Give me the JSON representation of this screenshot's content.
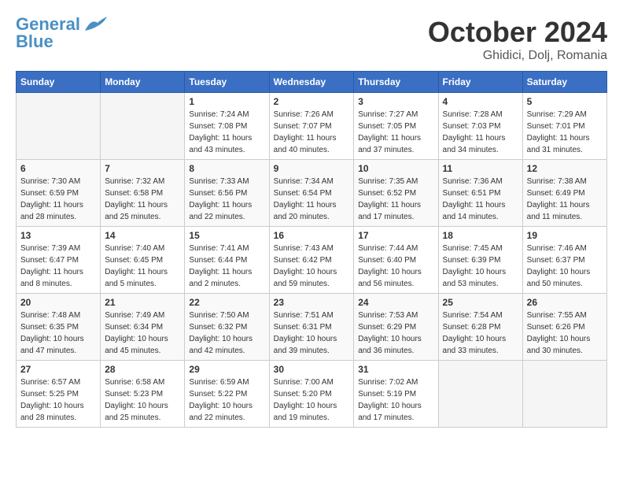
{
  "header": {
    "logo_line1": "General",
    "logo_line2": "Blue",
    "month": "October 2024",
    "location": "Ghidici, Dolj, Romania"
  },
  "weekdays": [
    "Sunday",
    "Monday",
    "Tuesday",
    "Wednesday",
    "Thursday",
    "Friday",
    "Saturday"
  ],
  "weeks": [
    [
      {
        "day": "",
        "info": ""
      },
      {
        "day": "",
        "info": ""
      },
      {
        "day": "1",
        "info": "Sunrise: 7:24 AM\nSunset: 7:08 PM\nDaylight: 11 hours and 43 minutes."
      },
      {
        "day": "2",
        "info": "Sunrise: 7:26 AM\nSunset: 7:07 PM\nDaylight: 11 hours and 40 minutes."
      },
      {
        "day": "3",
        "info": "Sunrise: 7:27 AM\nSunset: 7:05 PM\nDaylight: 11 hours and 37 minutes."
      },
      {
        "day": "4",
        "info": "Sunrise: 7:28 AM\nSunset: 7:03 PM\nDaylight: 11 hours and 34 minutes."
      },
      {
        "day": "5",
        "info": "Sunrise: 7:29 AM\nSunset: 7:01 PM\nDaylight: 11 hours and 31 minutes."
      }
    ],
    [
      {
        "day": "6",
        "info": "Sunrise: 7:30 AM\nSunset: 6:59 PM\nDaylight: 11 hours and 28 minutes."
      },
      {
        "day": "7",
        "info": "Sunrise: 7:32 AM\nSunset: 6:58 PM\nDaylight: 11 hours and 25 minutes."
      },
      {
        "day": "8",
        "info": "Sunrise: 7:33 AM\nSunset: 6:56 PM\nDaylight: 11 hours and 22 minutes."
      },
      {
        "day": "9",
        "info": "Sunrise: 7:34 AM\nSunset: 6:54 PM\nDaylight: 11 hours and 20 minutes."
      },
      {
        "day": "10",
        "info": "Sunrise: 7:35 AM\nSunset: 6:52 PM\nDaylight: 11 hours and 17 minutes."
      },
      {
        "day": "11",
        "info": "Sunrise: 7:36 AM\nSunset: 6:51 PM\nDaylight: 11 hours and 14 minutes."
      },
      {
        "day": "12",
        "info": "Sunrise: 7:38 AM\nSunset: 6:49 PM\nDaylight: 11 hours and 11 minutes."
      }
    ],
    [
      {
        "day": "13",
        "info": "Sunrise: 7:39 AM\nSunset: 6:47 PM\nDaylight: 11 hours and 8 minutes."
      },
      {
        "day": "14",
        "info": "Sunrise: 7:40 AM\nSunset: 6:45 PM\nDaylight: 11 hours and 5 minutes."
      },
      {
        "day": "15",
        "info": "Sunrise: 7:41 AM\nSunset: 6:44 PM\nDaylight: 11 hours and 2 minutes."
      },
      {
        "day": "16",
        "info": "Sunrise: 7:43 AM\nSunset: 6:42 PM\nDaylight: 10 hours and 59 minutes."
      },
      {
        "day": "17",
        "info": "Sunrise: 7:44 AM\nSunset: 6:40 PM\nDaylight: 10 hours and 56 minutes."
      },
      {
        "day": "18",
        "info": "Sunrise: 7:45 AM\nSunset: 6:39 PM\nDaylight: 10 hours and 53 minutes."
      },
      {
        "day": "19",
        "info": "Sunrise: 7:46 AM\nSunset: 6:37 PM\nDaylight: 10 hours and 50 minutes."
      }
    ],
    [
      {
        "day": "20",
        "info": "Sunrise: 7:48 AM\nSunset: 6:35 PM\nDaylight: 10 hours and 47 minutes."
      },
      {
        "day": "21",
        "info": "Sunrise: 7:49 AM\nSunset: 6:34 PM\nDaylight: 10 hours and 45 minutes."
      },
      {
        "day": "22",
        "info": "Sunrise: 7:50 AM\nSunset: 6:32 PM\nDaylight: 10 hours and 42 minutes."
      },
      {
        "day": "23",
        "info": "Sunrise: 7:51 AM\nSunset: 6:31 PM\nDaylight: 10 hours and 39 minutes."
      },
      {
        "day": "24",
        "info": "Sunrise: 7:53 AM\nSunset: 6:29 PM\nDaylight: 10 hours and 36 minutes."
      },
      {
        "day": "25",
        "info": "Sunrise: 7:54 AM\nSunset: 6:28 PM\nDaylight: 10 hours and 33 minutes."
      },
      {
        "day": "26",
        "info": "Sunrise: 7:55 AM\nSunset: 6:26 PM\nDaylight: 10 hours and 30 minutes."
      }
    ],
    [
      {
        "day": "27",
        "info": "Sunrise: 6:57 AM\nSunset: 5:25 PM\nDaylight: 10 hours and 28 minutes."
      },
      {
        "day": "28",
        "info": "Sunrise: 6:58 AM\nSunset: 5:23 PM\nDaylight: 10 hours and 25 minutes."
      },
      {
        "day": "29",
        "info": "Sunrise: 6:59 AM\nSunset: 5:22 PM\nDaylight: 10 hours and 22 minutes."
      },
      {
        "day": "30",
        "info": "Sunrise: 7:00 AM\nSunset: 5:20 PM\nDaylight: 10 hours and 19 minutes."
      },
      {
        "day": "31",
        "info": "Sunrise: 7:02 AM\nSunset: 5:19 PM\nDaylight: 10 hours and 17 minutes."
      },
      {
        "day": "",
        "info": ""
      },
      {
        "day": "",
        "info": ""
      }
    ]
  ]
}
